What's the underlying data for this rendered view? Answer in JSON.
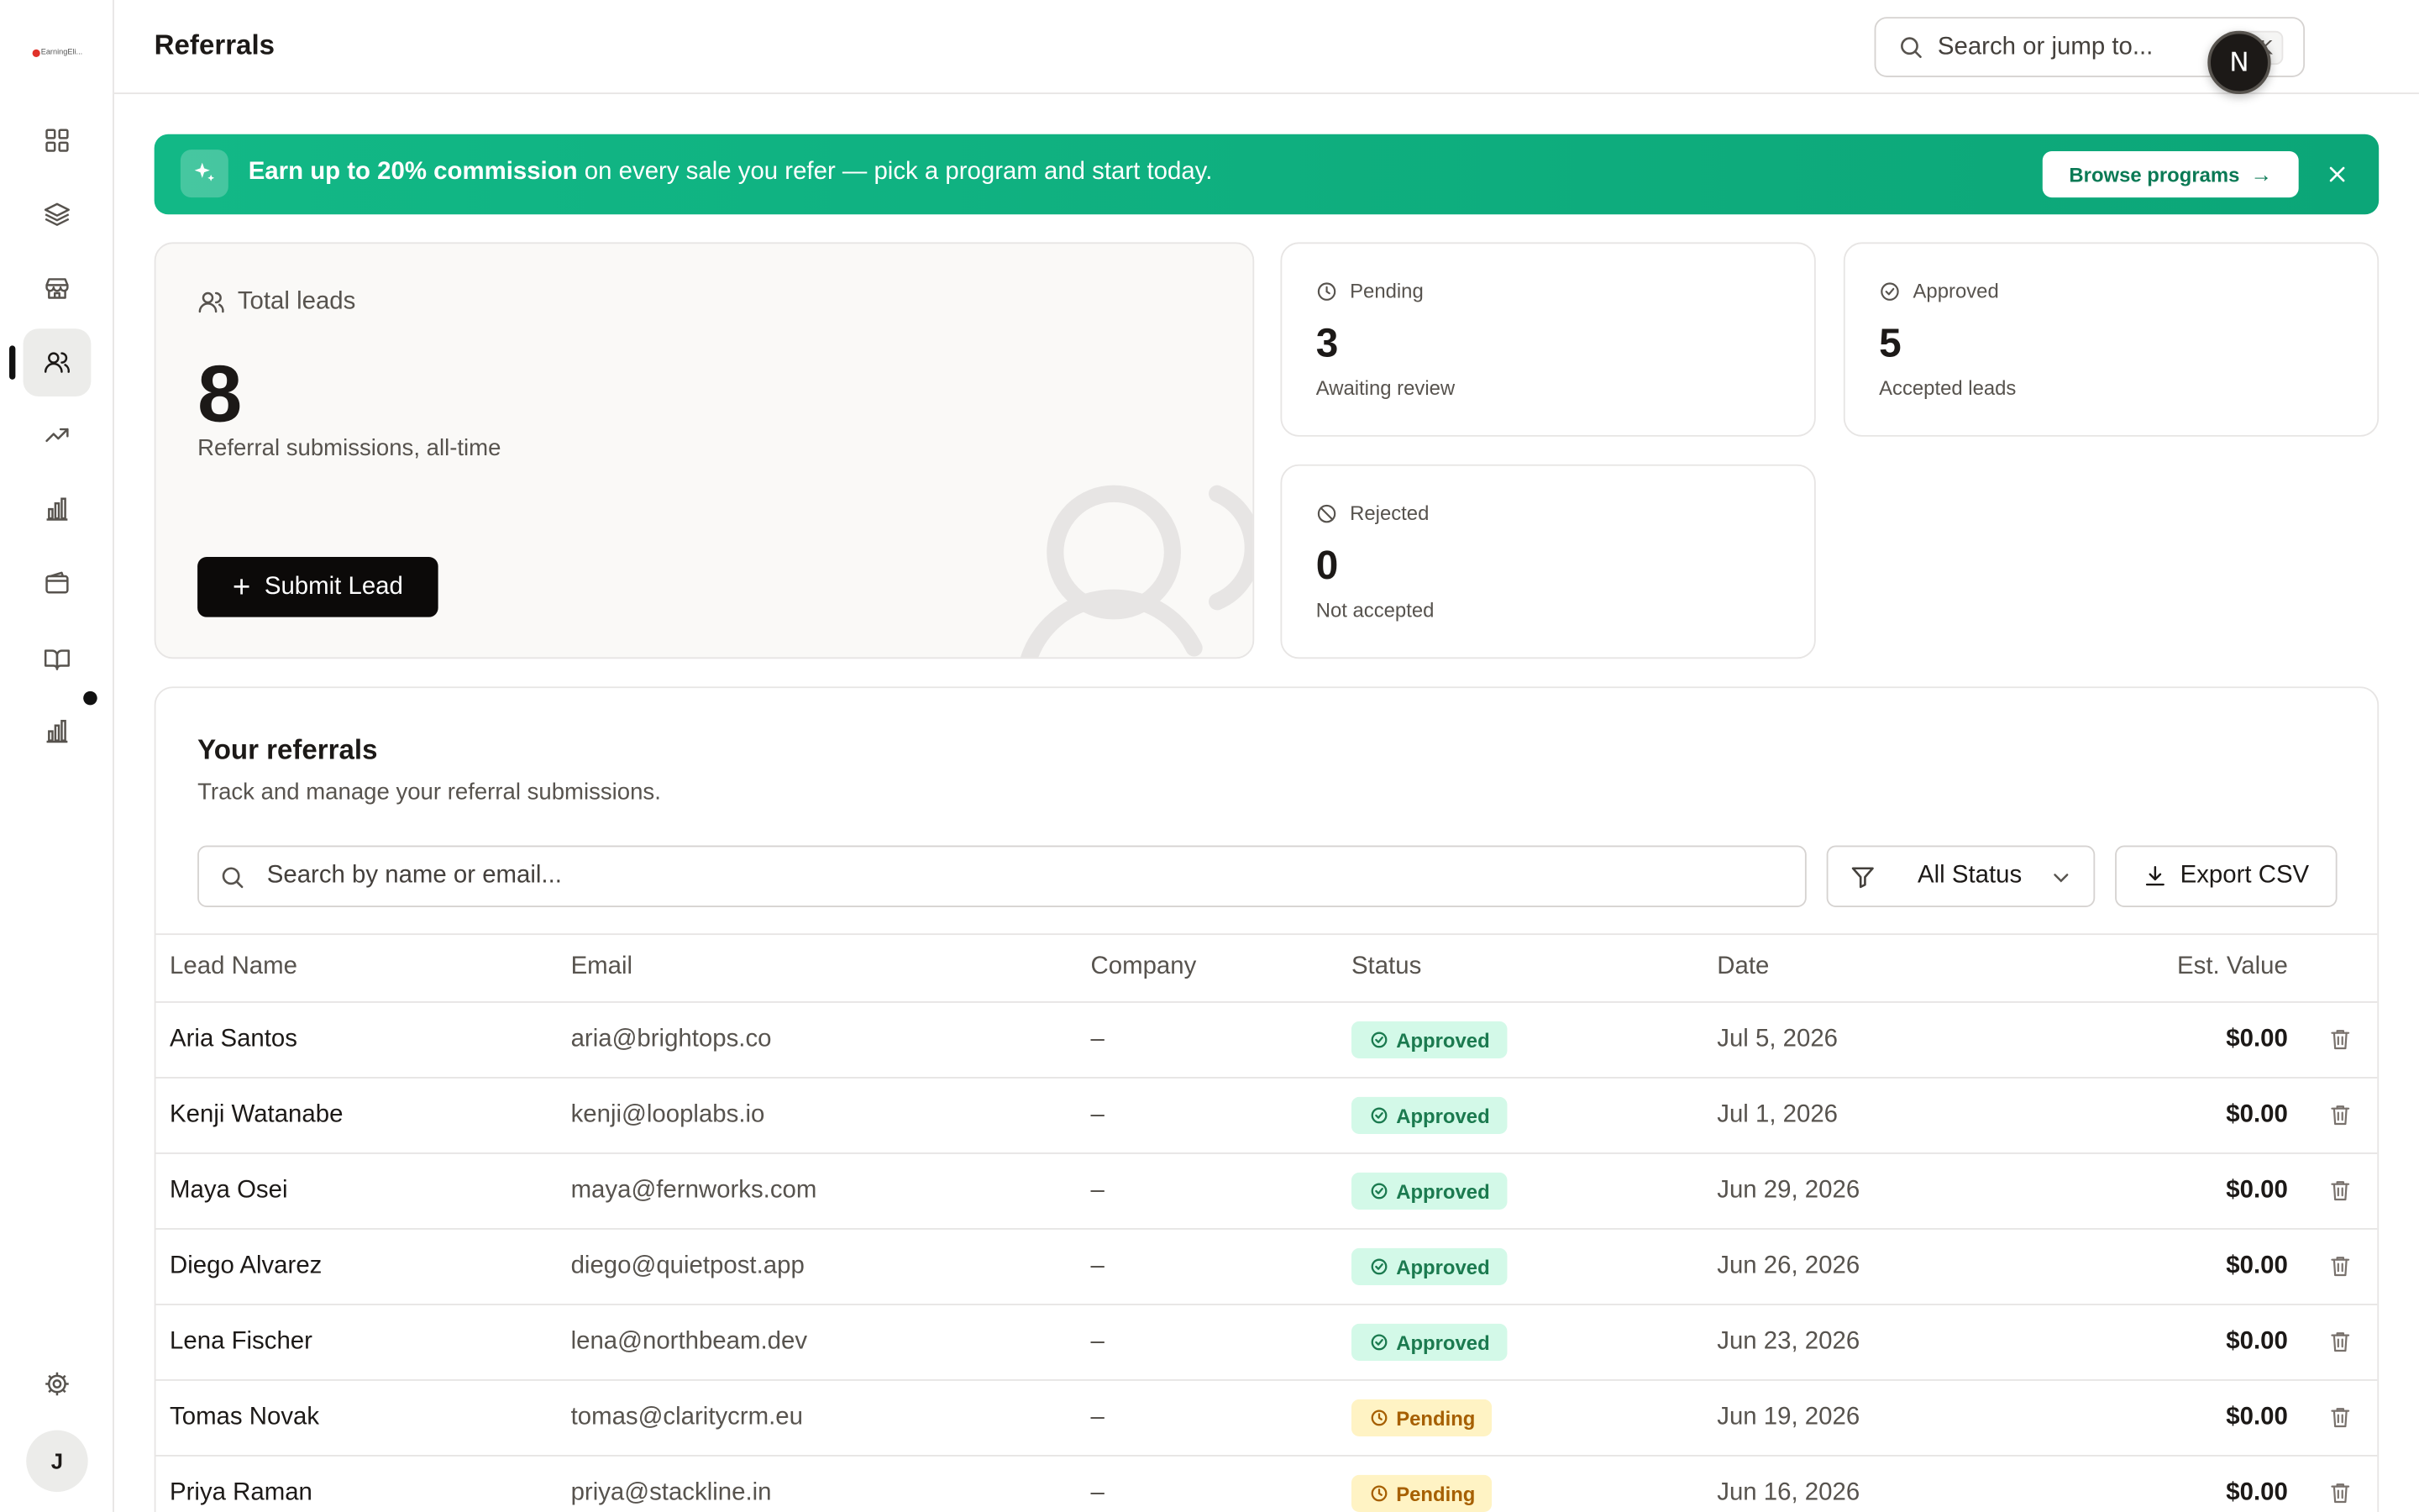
{
  "sidebar": {
    "brand": "EarningEli...",
    "nav": [
      {
        "name": "dashboard",
        "icon": "grid-icon"
      },
      {
        "name": "layers",
        "icon": "layers-icon"
      },
      {
        "name": "store",
        "icon": "store-icon"
      },
      {
        "name": "referrals",
        "icon": "users-icon",
        "active": true
      },
      {
        "name": "trending",
        "icon": "trending-up-icon"
      },
      {
        "name": "analytics",
        "icon": "bar-chart-icon"
      },
      {
        "name": "wallet",
        "icon": "wallet-icon"
      },
      {
        "name": "docs",
        "icon": "book-icon"
      },
      {
        "name": "reports",
        "icon": "bar-chart-icon"
      }
    ],
    "user_initial": "J"
  },
  "header": {
    "title": "Referrals",
    "search_placeholder": "Search or jump to...",
    "shortcut": "⌘ K",
    "avatar_initial": "N"
  },
  "banner": {
    "bold_text": "Earn up to 20% commission",
    "text": " on every sale you refer — pick a program and start today.",
    "button_label": "Browse programs",
    "color": "#0ca678"
  },
  "stats": {
    "total": {
      "label": "Total leads",
      "value": "8",
      "sub": "Referral submissions, all-time",
      "button": "Submit Lead"
    },
    "pending": {
      "label": "Pending",
      "value": "3",
      "sub": "Awaiting review"
    },
    "approved": {
      "label": "Approved",
      "value": "5",
      "sub": "Accepted leads"
    },
    "rejected": {
      "label": "Rejected",
      "value": "0",
      "sub": "Not accepted"
    }
  },
  "referrals": {
    "title": "Your referrals",
    "subtitle": "Track and manage your referral submissions.",
    "search_placeholder": "Search by name or email...",
    "status_filter": "All Status",
    "export_label": "Export CSV",
    "columns": [
      "Lead Name",
      "Email",
      "Company",
      "Status",
      "Date",
      "Est. Value"
    ],
    "rows": [
      {
        "name": "Aria Santos",
        "email": "aria@brightops.co",
        "company": "–",
        "status": "Approved",
        "date": "Jul 5, 2026",
        "value": "$0.00"
      },
      {
        "name": "Kenji Watanabe",
        "email": "kenji@looplabs.io",
        "company": "–",
        "status": "Approved",
        "date": "Jul 1, 2026",
        "value": "$0.00"
      },
      {
        "name": "Maya Osei",
        "email": "maya@fernworks.com",
        "company": "–",
        "status": "Approved",
        "date": "Jun 29, 2026",
        "value": "$0.00"
      },
      {
        "name": "Diego Alvarez",
        "email": "diego@quietpost.app",
        "company": "–",
        "status": "Approved",
        "date": "Jun 26, 2026",
        "value": "$0.00"
      },
      {
        "name": "Lena Fischer",
        "email": "lena@northbeam.dev",
        "company": "–",
        "status": "Approved",
        "date": "Jun 23, 2026",
        "value": "$0.00"
      },
      {
        "name": "Tomas Novak",
        "email": "tomas@claritycrm.eu",
        "company": "–",
        "status": "Pending",
        "date": "Jun 19, 2026",
        "value": "$0.00"
      },
      {
        "name": "Priya Raman",
        "email": "priya@stackline.in",
        "company": "–",
        "status": "Pending",
        "date": "Jun 16, 2026",
        "value": "$0.00"
      }
    ]
  }
}
